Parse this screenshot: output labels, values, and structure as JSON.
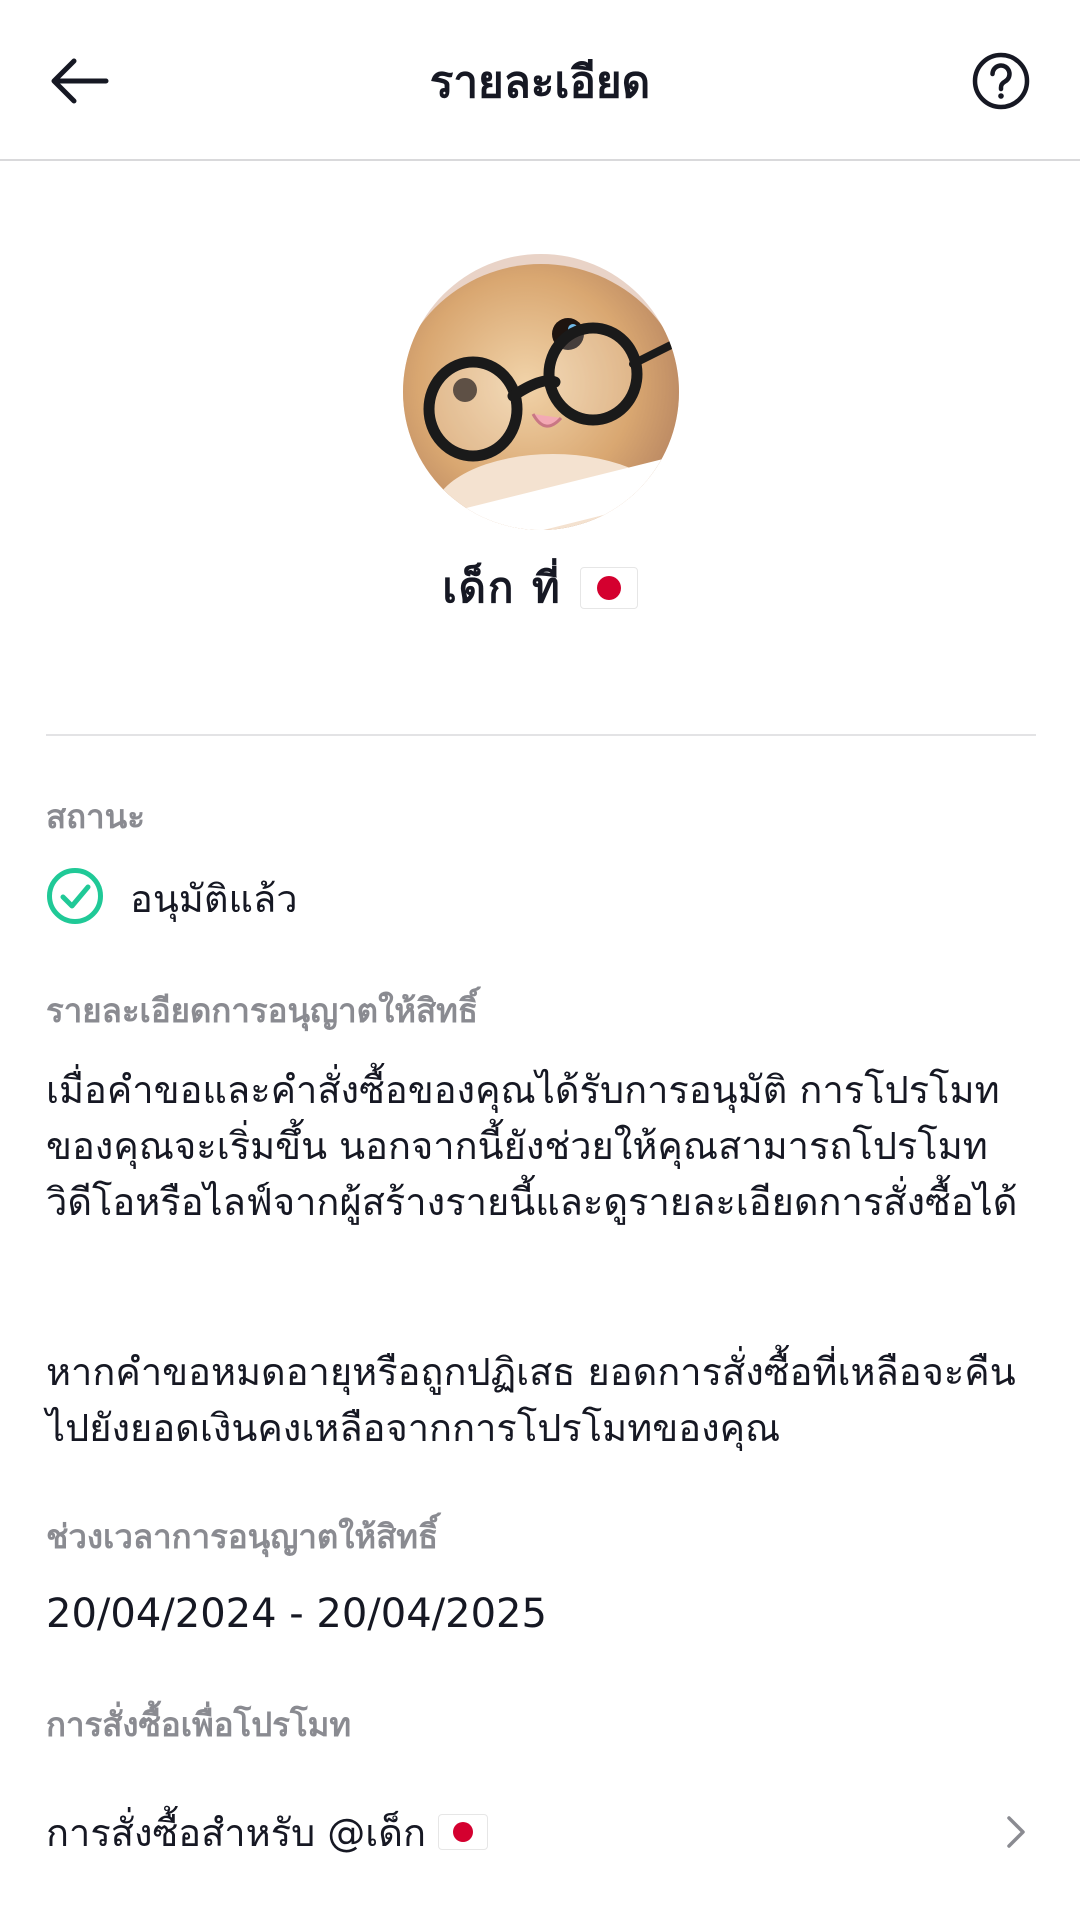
{
  "header": {
    "title": "รายละเอียด",
    "back_icon": "arrow-left-icon",
    "help_icon": "question-circle-icon"
  },
  "profile": {
    "display_name": "เด็ก ที่",
    "flag_icon": "japan-flag-icon"
  },
  "status": {
    "label": "สถานะ",
    "value": "อนุมัติแล้ว",
    "icon": "check-circle-icon",
    "color": "#20c997"
  },
  "license_details": {
    "label": "รายละเอียดการอนุญาตให้สิทธิ์",
    "paragraph_1": "เมื่อคำขอและคำสั่งซื้อของคุณได้รับการอนุมัติ การโปรโมทของคุณจะเริ่มขึ้น นอกจากนี้ยังช่วยให้คุณสามารถโปรโมทวิดีโอหรือไลฟ์จากผู้สร้างรายนี้และดูรายละเอียดการสั่งซื้อได้",
    "paragraph_2": "หากคำขอหมดอายุหรือถูกปฏิเสธ ยอดการสั่งซื้อที่เหลือจะคืนไปยังยอดเงินคงเหลือจากการโปรโมทของคุณ"
  },
  "license_period": {
    "label": "ช่วงเวลาการอนุญาตให้สิทธิ์",
    "value": "20/04/2024 - 20/04/2025"
  },
  "promotion_orders": {
    "label": "การสั่งซื้อเพื่อโปรโมท",
    "row_text": "การสั่งซื้อสำหรับ @เด็ก",
    "chevron_icon": "chevron-right-icon"
  }
}
